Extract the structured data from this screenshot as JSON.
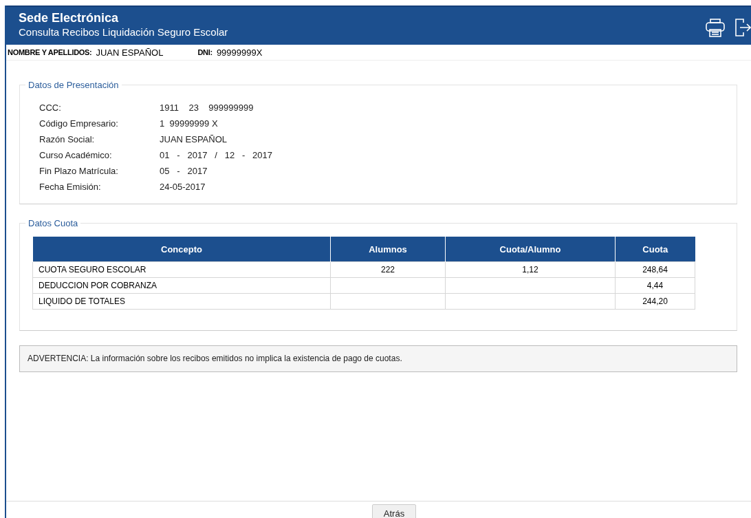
{
  "header": {
    "title": "Sede Electrónica",
    "subtitle": "Consulta Recibos Liquidación Seguro Escolar"
  },
  "person": [
    {
      "label": "NOMBRE Y APELLIDOS:",
      "value": "JUAN ESPAÑOL"
    },
    {
      "label": "DNI:",
      "value": "99999999X"
    }
  ],
  "presentation": {
    "legend": "Datos de Presentación",
    "fields": [
      {
        "label": "CCC:",
        "value": "1911    23    999999999"
      },
      {
        "label": "Código Empresario:",
        "value": "1  99999999 X"
      },
      {
        "label": "Razón Social:",
        "value": "JUAN ESPAÑOL"
      },
      {
        "label": "Curso Académico:",
        "value": "01   -   2017   /   12   -   2017"
      },
      {
        "label": "Fin Plazo Matrícula:",
        "value": "05   -   2017"
      },
      {
        "label": "Fecha Emisión:",
        "value": "24-05-2017"
      }
    ]
  },
  "fees": {
    "legend": "Datos Cuota",
    "columns": [
      "Concepto",
      "Alumnos",
      "Cuota/Alumno",
      "Cuota"
    ],
    "rows": [
      [
        "CUOTA SEGURO ESCOLAR",
        "222",
        "1,12",
        "248,64"
      ],
      [
        "DEDUCCION POR COBRANZA",
        "",
        "",
        "4,44"
      ],
      [
        "LIQUIDO DE TOTALES",
        "",
        "",
        "244,20"
      ]
    ]
  },
  "warning": "ADVERTENCIA: La información sobre los recibos emitidos no implica la existencia de pago de cuotas.",
  "back_button": "Atrás"
}
